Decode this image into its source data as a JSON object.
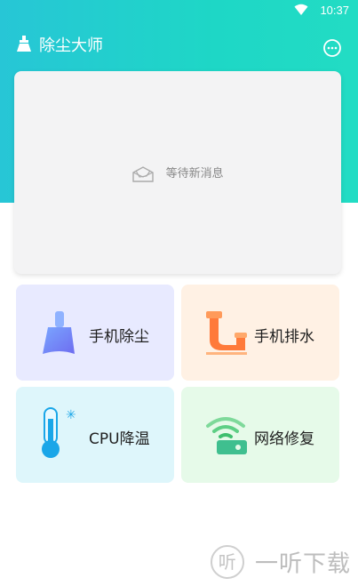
{
  "status_bar": {
    "time": "10:37"
  },
  "header": {
    "title": "除尘大师"
  },
  "messages": {
    "empty_text": "等待新消息"
  },
  "tools": [
    {
      "label": "手机除尘",
      "icon": "broom-icon"
    },
    {
      "label": "手机排水",
      "icon": "drain-pipe-icon"
    },
    {
      "label": "CPU降温",
      "icon": "thermometer-icon"
    },
    {
      "label": "网络修复",
      "icon": "wifi-router-icon"
    }
  ],
  "watermark": {
    "badge": "听",
    "text": "一听下载"
  },
  "colors": {
    "header_gradient_start": "#27c6d6",
    "header_gradient_end": "#22dcc4",
    "card_clean_bg": "#e8eaff",
    "card_drain_bg": "#fff1e4",
    "card_cpu_bg": "#def6fb",
    "card_repair_bg": "#e6fae9"
  }
}
